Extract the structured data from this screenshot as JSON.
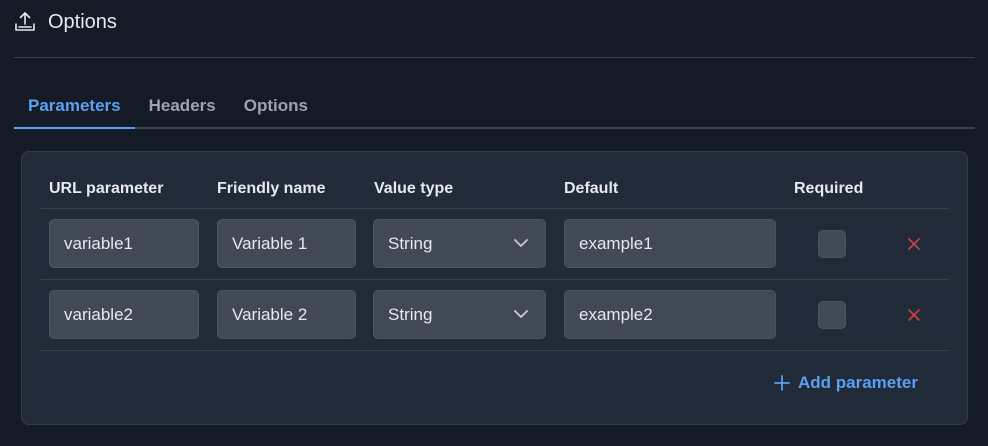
{
  "header": {
    "title": "Options",
    "icon": "upload-icon"
  },
  "tabs": [
    {
      "label": "Parameters",
      "active": true
    },
    {
      "label": "Headers",
      "active": false
    },
    {
      "label": "Options",
      "active": false
    }
  ],
  "table": {
    "columns": [
      "URL parameter",
      "Friendly name",
      "Value type",
      "Default",
      "Required"
    ],
    "rows": [
      {
        "url_parameter": "variable1",
        "friendly_name": "Variable 1",
        "value_type": "String",
        "default": "example1",
        "required": false
      },
      {
        "url_parameter": "variable2",
        "friendly_name": "Variable 2",
        "value_type": "String",
        "default": "example2",
        "required": false
      }
    ]
  },
  "add_button": {
    "label": "Add parameter",
    "icon": "plus-icon"
  },
  "colors": {
    "accent": "#5b9ff2",
    "delete": "#d0403f",
    "background": "#141b27",
    "panel": "#202a38"
  }
}
